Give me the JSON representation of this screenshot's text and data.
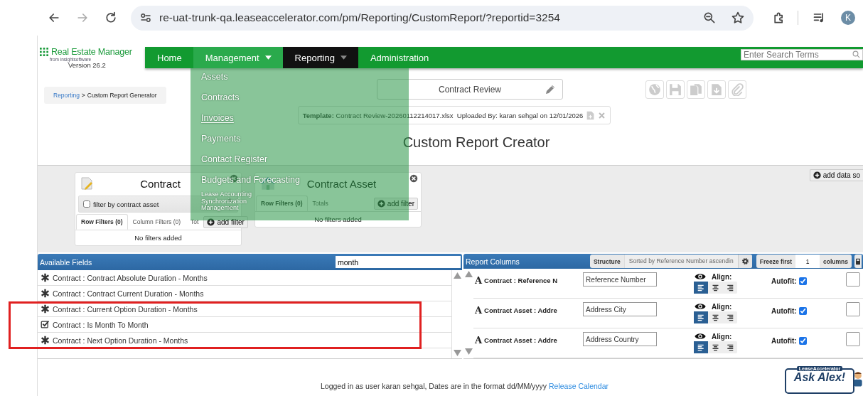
{
  "browser": {
    "url": "re-uat-trunk-qa.leaseaccelerator.com/pm/Reporting/CustomReport/?reportid=3254",
    "profile_initial": "K"
  },
  "app": {
    "logo": "Real Estate Manager",
    "logo_sub": "from insightsoftware",
    "version": "Version 26.2"
  },
  "nav": {
    "items": [
      {
        "label": "Home",
        "selected": false,
        "expanded": false,
        "has_menu": false
      },
      {
        "label": "Management",
        "selected": false,
        "expanded": true,
        "has_menu": true
      },
      {
        "label": "Reporting",
        "selected": true,
        "expanded": false,
        "has_menu": true
      },
      {
        "label": "Administration",
        "selected": false,
        "expanded": false,
        "has_menu": false
      }
    ],
    "search_placeholder": "Enter Search Terms"
  },
  "menu": {
    "items": [
      {
        "label": "Assets",
        "hovered": false
      },
      {
        "label": "Contracts",
        "hovered": false
      },
      {
        "label": "Invoices",
        "hovered": true
      },
      {
        "label": "Payments",
        "hovered": false
      },
      {
        "label": "Contact Register",
        "hovered": false
      },
      {
        "label": "Budgets and Forecasting",
        "hovered": false
      },
      {
        "label": "Lease Accounting Synchronization Management",
        "hovered": false
      }
    ]
  },
  "breadcrumb": {
    "items": [
      {
        "label": "Reporting",
        "link": true
      },
      {
        "label": "Custom Report Generator",
        "link": false
      }
    ],
    "separator": ">"
  },
  "report_name": "Contract Review",
  "template": {
    "label": "Template:",
    "file": "Contract Review-20260112214017.xlsx",
    "uploaded": "Uploaded By: karan sehgal on 12/01/2026"
  },
  "title": "Custom Report Creator",
  "data_sources": [
    {
      "name": "Contract",
      "filter_option": {
        "label": "filter by contract asset",
        "checked": false
      },
      "tabs": [
        {
          "label": "Row Filters (0)",
          "selected": true
        },
        {
          "label": "Column Filters (0)",
          "selected": false
        },
        {
          "label": "Tot",
          "selected": false
        }
      ],
      "add_filter": "add filter",
      "empty": "No filters added"
    },
    {
      "name": "Contract Asset",
      "tabs": [
        {
          "label": "Row Filters (0)",
          "selected": true
        },
        {
          "label": "Totals",
          "selected": false
        }
      ],
      "add_filter": "add filter",
      "empty": "No filters added"
    }
  ],
  "add_data_source": "add data so",
  "available_fields": {
    "title": "Available Fields",
    "search": "month",
    "items": [
      {
        "label": "Contract : Contract Absolute Duration - Months",
        "kind": "number"
      },
      {
        "label": "Contract : Contract Current Duration - Months",
        "kind": "number"
      },
      {
        "label": "Contract : Current Option Duration - Months",
        "kind": "number"
      },
      {
        "label": "Contract : Is Month To Month",
        "kind": "boolean"
      },
      {
        "label": "Contract : Next Option Duration - Months",
        "kind": "number"
      }
    ]
  },
  "report_columns": {
    "title": "Report Columns",
    "structure_label": "Structure",
    "sort": "Sorted by Reference Number ascendin",
    "freeze_label": "Freeze first",
    "freeze_value": "1",
    "freeze_suffix": "columns",
    "rows": [
      {
        "type_icon": "A",
        "field": "Contract : Reference N",
        "header": "Reference Number",
        "visible": true,
        "align_label": "Align:",
        "alignment": [
          {
            "kind": "left",
            "selected": true
          },
          {
            "kind": "center",
            "selected": false
          },
          {
            "kind": "right",
            "selected": false
          }
        ],
        "autofit_label": "Autofit:",
        "autofit": true,
        "checked": false
      },
      {
        "type_icon": "A",
        "field": "Contract Asset : Addre",
        "header": "Address City",
        "visible": true,
        "align_label": "Align:",
        "alignment": [
          {
            "kind": "left",
            "selected": true
          },
          {
            "kind": "center",
            "selected": false
          },
          {
            "kind": "right",
            "selected": false
          }
        ],
        "autofit_label": "Autofit:",
        "autofit": true,
        "checked": false
      },
      {
        "type_icon": "A",
        "field": "Contract Asset : Addre",
        "header": "Address Country",
        "visible": true,
        "align_label": "Align:",
        "alignment": [
          {
            "kind": "left",
            "selected": true
          },
          {
            "kind": "center",
            "selected": false
          },
          {
            "kind": "right",
            "selected": false
          }
        ],
        "autofit_label": "Autofit:",
        "autofit": true,
        "checked": false
      }
    ]
  },
  "footer": {
    "text": "Logged in as user karan sehgal, Dates are in the format dd/MM/yyyy",
    "link": "Release Calendar"
  },
  "help_badge": {
    "brand": "LeaseAccelerator",
    "label": "Ask Alex!"
  }
}
